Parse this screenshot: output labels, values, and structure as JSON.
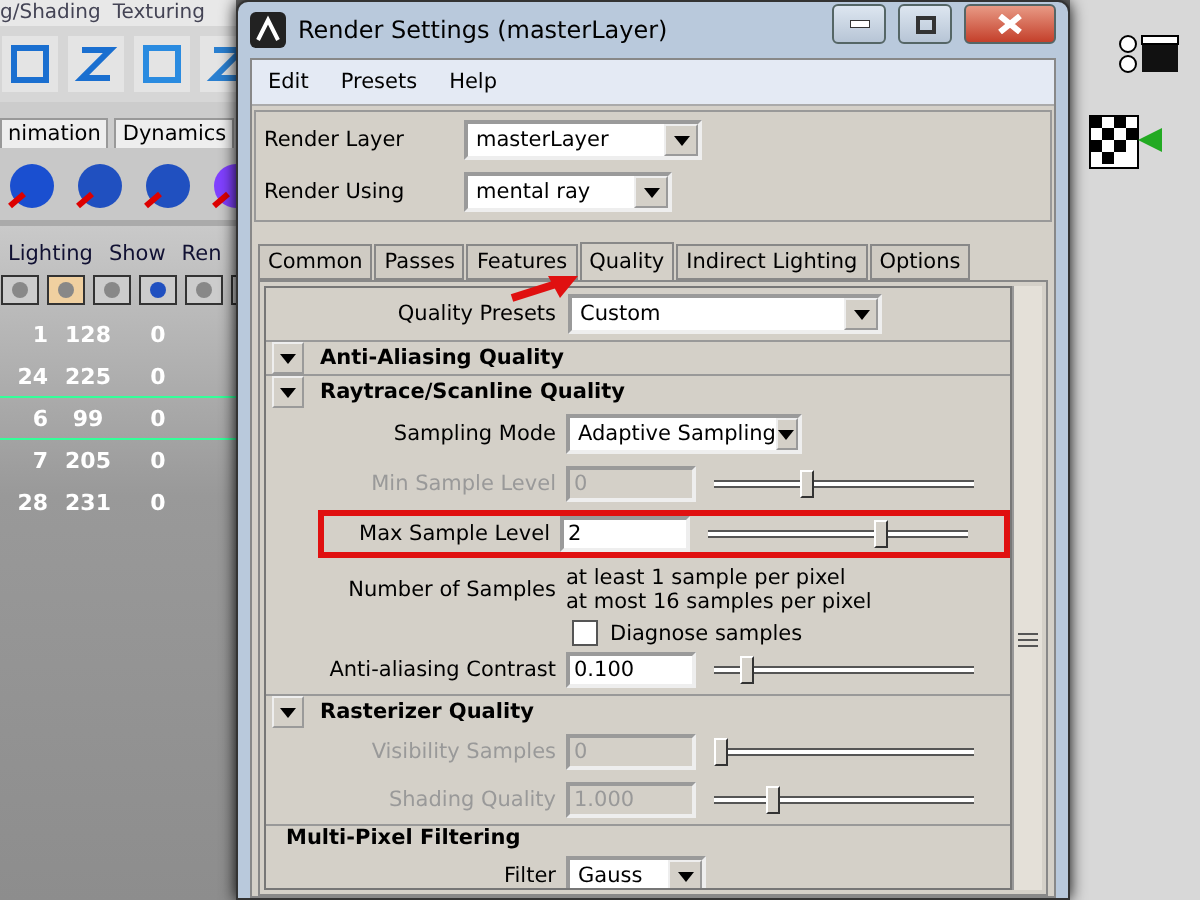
{
  "background_app": {
    "menu": [
      "g/Shading",
      "Texturing"
    ],
    "shelf_tabs": [
      "nimation",
      "Dynamics"
    ],
    "panel_menu": [
      "Lighting",
      "Show",
      "Ren"
    ],
    "rows": [
      [
        "1",
        "128",
        "0"
      ],
      [
        "24",
        "225",
        "0"
      ],
      [
        "6",
        "99",
        "0"
      ],
      [
        "7",
        "205",
        "0"
      ],
      [
        "28",
        "231",
        "0"
      ]
    ]
  },
  "window": {
    "title": "Render Settings (masterLayer)",
    "menu": [
      "Edit",
      "Presets",
      "Help"
    ],
    "render_layer": {
      "label": "Render Layer",
      "value": "masterLayer"
    },
    "render_using": {
      "label": "Render Using",
      "value": "mental ray"
    },
    "tabs": [
      {
        "label": "Common",
        "selected": false
      },
      {
        "label": "Passes",
        "selected": false
      },
      {
        "label": "Features",
        "selected": false
      },
      {
        "label": "Quality",
        "selected": true
      },
      {
        "label": "Indirect Lighting",
        "selected": false
      },
      {
        "label": "Options",
        "selected": false
      }
    ],
    "quality_presets": {
      "label": "Quality Presets",
      "value": "Custom"
    },
    "sections": [
      {
        "title": "Anti-Aliasing Quality",
        "collapsible": true
      },
      {
        "title": "Raytrace/Scanline Quality",
        "collapsible": true,
        "rows": [
          {
            "kind": "dropdown",
            "label": "Sampling Mode",
            "value": "Adaptive Sampling"
          },
          {
            "kind": "slider",
            "label": "Min Sample Level",
            "value": "0",
            "level": 0.35,
            "disabled": true,
            "highlighted": false
          },
          {
            "kind": "slider",
            "label": "Max Sample Level",
            "value": "2",
            "level": 0.66,
            "disabled": false,
            "highlighted": true
          },
          {
            "kind": "info",
            "label": "Number of Samples",
            "lines": [
              "at least 1 sample per pixel",
              "at most 16 samples per pixel"
            ]
          },
          {
            "kind": "checkbox",
            "label": "Diagnose samples",
            "checked": false
          },
          {
            "kind": "slider",
            "label": "Anti-aliasing Contrast",
            "value": "0.100",
            "level": 0.12,
            "disabled": false,
            "highlighted": false
          }
        ]
      },
      {
        "title": "Rasterizer Quality",
        "collapsible": true,
        "rows": [
          {
            "kind": "slider",
            "label": "Visibility Samples",
            "value": "0",
            "level": 0.02,
            "disabled": true,
            "highlighted": false
          },
          {
            "kind": "slider",
            "label": "Shading Quality",
            "value": "1.000",
            "level": 0.22,
            "disabled": true,
            "highlighted": false
          }
        ]
      },
      {
        "title": "Multi-Pixel Filtering",
        "collapsible": false,
        "rows": [
          {
            "kind": "dropdown",
            "label": "Filter",
            "value": "Gauss"
          }
        ]
      }
    ]
  }
}
